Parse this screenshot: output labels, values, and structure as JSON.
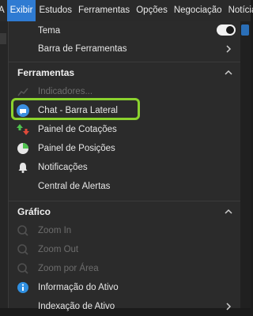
{
  "menubar": {
    "items": [
      "A",
      "Exibir",
      "Estudos",
      "Ferramentas",
      "Opções",
      "Negociação",
      "Notícias"
    ],
    "active_index": 1
  },
  "menu": {
    "tema": {
      "label": "Tema",
      "toggle_on": true
    },
    "barra_ferramentas": {
      "label": "Barra de Ferramentas"
    },
    "sections": {
      "ferramentas": "Ferramentas",
      "grafico": "Gráfico"
    },
    "ferramentas_items": [
      {
        "label": "Indicadores...",
        "icon": "indicators-icon",
        "disabled": true
      },
      {
        "label": "Chat - Barra Lateral",
        "icon": "chat-icon",
        "disabled": false,
        "highlighted": true
      },
      {
        "label": "Painel de Cotações",
        "icon": "quotes-panel-icon",
        "disabled": false
      },
      {
        "label": "Painel de Posições",
        "icon": "positions-panel-icon",
        "disabled": false
      },
      {
        "label": "Notificações",
        "icon": "bell-icon",
        "disabled": false
      },
      {
        "label": "Central de Alertas",
        "icon": "",
        "disabled": false
      }
    ],
    "grafico_items": [
      {
        "label": "Zoom In",
        "icon": "zoom-in-icon",
        "disabled": true
      },
      {
        "label": "Zoom Out",
        "icon": "zoom-out-icon",
        "disabled": true
      },
      {
        "label": "Zoom por Área",
        "icon": "zoom-area-icon",
        "disabled": true
      },
      {
        "label": "Informação do Ativo",
        "icon": "info-icon",
        "disabled": false
      },
      {
        "label": "Indexação de Ativo",
        "icon": "",
        "disabled": false
      }
    ]
  },
  "colors": {
    "active_menu": "#2f7bd2",
    "highlight_border": "#8bd22e"
  }
}
